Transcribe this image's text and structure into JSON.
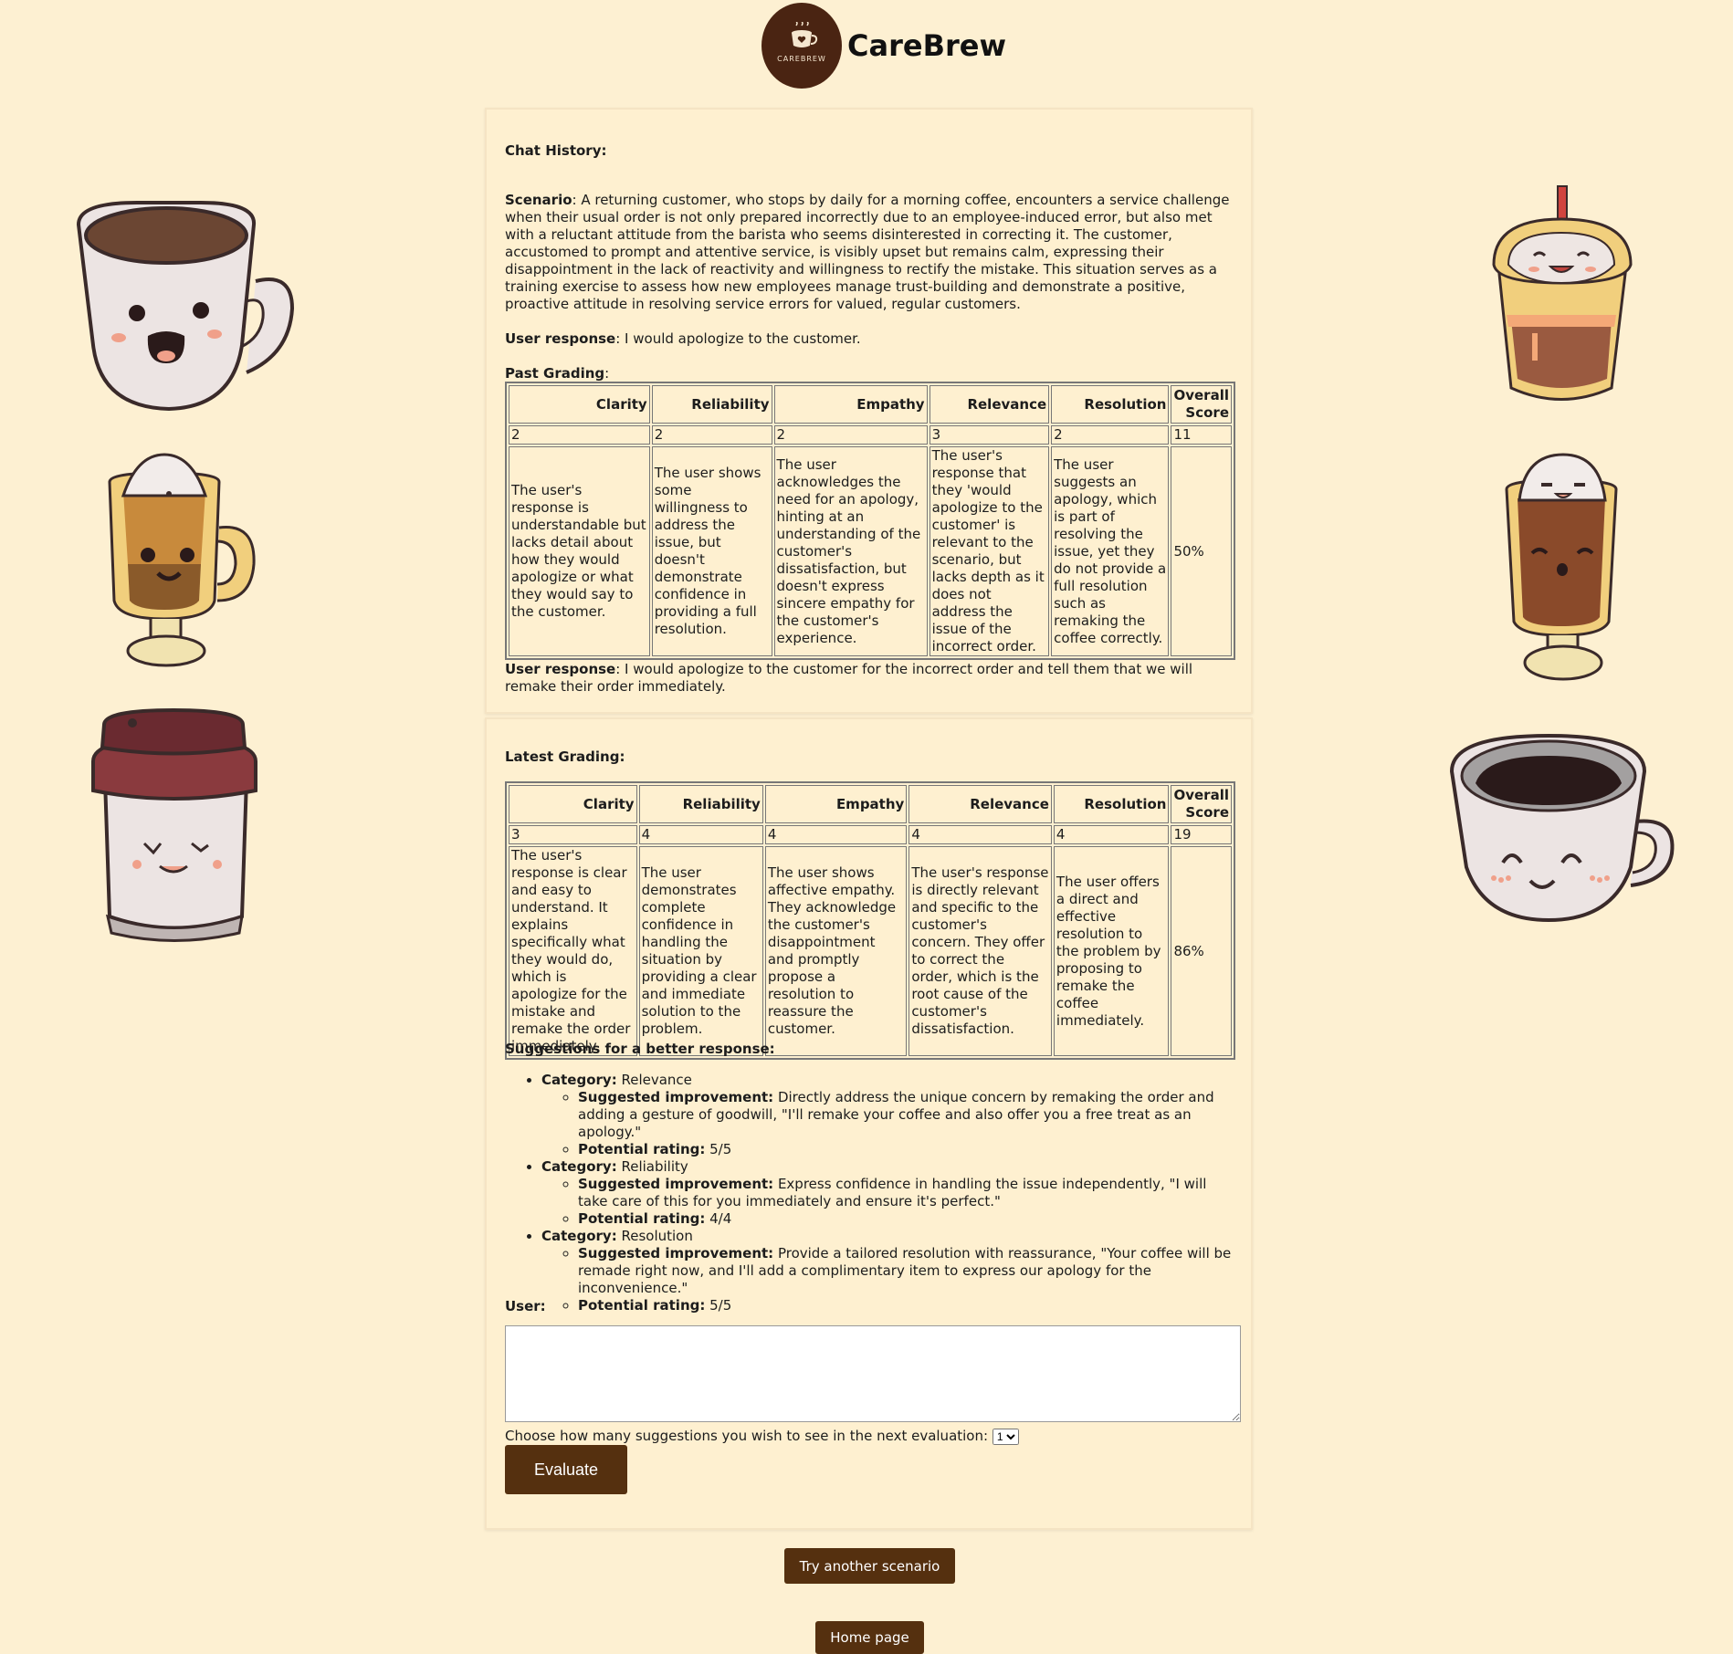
{
  "header": {
    "brand": "CareBrew",
    "logo_text": "CAREBREW"
  },
  "chat": {
    "heading": "Chat History:",
    "scenario_label": "Scenario",
    "scenario_text": ": A returning customer, who stops by daily for a morning coffee, encounters a service challenge when their usual order is not only prepared incorrectly due to an employee-induced error, but also met with a reluctant attitude from the barista who seems disinterested in correcting it. The customer, accustomed to prompt and attentive service, is visibly upset but remains calm, expressing their disappointment in the lack of reactivity and willingness to rectify the mistake. This situation serves as a training exercise to assess how new employees manage trust-building and demonstrate a positive, proactive attitude in resolving service errors for valued, regular customers.",
    "user_response_label": "User response",
    "user_response_1": ": I would apologize to the customer.",
    "past_grading_label": "Past Grading",
    "user_response_2": ": I would apologize to the customer for the incorrect order and tell them that we will remake their order immediately."
  },
  "columns": [
    "Clarity",
    "Reliability",
    "Empathy",
    "Relevance",
    "Resolution",
    "Overall Score"
  ],
  "past": {
    "scores": [
      "2",
      "2",
      "2",
      "3",
      "2",
      "11"
    ],
    "comments": [
      "The user's response is understandable but lacks detail about how they would apologize or what they would say to the customer.",
      "The user shows some willingness to address the issue, but doesn't demonstrate confidence in providing a full resolution.",
      "The user acknowledges the need for an apology, hinting at an understanding of the customer's dissatisfaction, but doesn't express sincere empathy for the customer's experience.",
      "The user's response that they 'would apologize to the customer' is relevant to the scenario, but lacks depth as it does not address the issue of the incorrect order.",
      "The user suggests an apology, which is part of resolving the issue, yet they do not provide a full resolution such as remaking the coffee correctly.",
      "50%"
    ]
  },
  "latest": {
    "heading": "Latest Grading:",
    "scores": [
      "3",
      "4",
      "4",
      "4",
      "4",
      "19"
    ],
    "comments": [
      "The user's response is clear and easy to understand. It explains specifically what they would do, which is apologize for the mistake and remake the order immediately.",
      "The user demonstrates complete confidence in handling the situation by providing a clear and immediate solution to the problem.",
      "The user shows affective empathy. They acknowledge the customer's disappointment and promptly propose a resolution to reassure the customer.",
      "The user's response is directly relevant and specific to the customer's concern. They offer to correct the order, which is the root cause of the customer's dissatisfaction.",
      "The user offers a direct and effective resolution to the problem by proposing to remake the coffee immediately.",
      "86%"
    ]
  },
  "suggestions": {
    "heading": "Suggestions for a better response:",
    "category_label": "Category:",
    "improvement_label": "Suggested improvement:",
    "rating_label": "Potential rating:",
    "items": [
      {
        "category": " Relevance",
        "improvement": " Directly address the unique concern by remaking the order and adding a gesture of goodwill, \"I'll remake your coffee and also offer you a free treat as an apology.\"",
        "rating": " 5/5"
      },
      {
        "category": " Reliability",
        "improvement": " Express confidence in handling the issue independently, \"I will take care of this for you immediately and ensure it's perfect.\"",
        "rating": " 4/4"
      },
      {
        "category": " Resolution",
        "improvement": " Provide a tailored resolution with reassurance, \"Your coffee will be remade right now, and I'll add a complimentary item to express our apology for the inconvenience.\"",
        "rating": " 5/5"
      }
    ]
  },
  "form": {
    "user_label": "User:",
    "user_value": "",
    "choose_text": "Choose how many suggestions you wish to see in the next evaluation:",
    "select_value": "1",
    "evaluate_label": "Evaluate"
  },
  "footer": {
    "try_label": "Try another scenario",
    "home_label": "Home page"
  }
}
